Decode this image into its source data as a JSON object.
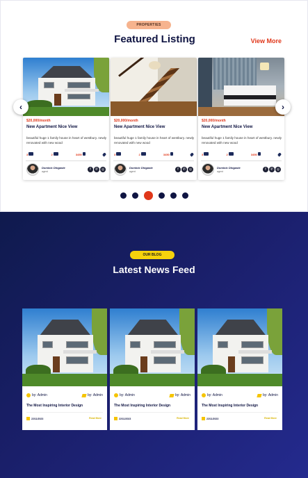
{
  "featured": {
    "tag": "PROPERTIES",
    "title": "Featured Listing",
    "view_more": "View More",
    "prev_icon": "chevron-left-icon",
    "next_icon": "chevron-right-icon",
    "cards": [
      {
        "image": "house-photo",
        "price": "$20,000/month",
        "title": "New Apartment Nice View",
        "description": "beautiful huge 1 family house in heart of westbury. newly renovated with new wood",
        "beds": "3",
        "baths": "2",
        "area": "3450",
        "agent_name": "Dominic Dhigaste",
        "agent_role": "agent"
      },
      {
        "image": "staircase-photo",
        "price": "$20,000/month",
        "title": "New Apartment Nice View",
        "description": "beautiful huge 1 family house in heart of westbury. newly renovated with new wood",
        "beds": "3",
        "baths": "2",
        "area": "3450",
        "agent_name": "Dominic Dhigaste",
        "agent_role": "agent"
      },
      {
        "image": "bedroom-photo",
        "price": "$20,000/month",
        "title": "New Apartment Nice View",
        "description": "beautiful huge 1 family house in heart of westbury. newly renovated with new wood",
        "beds": "3",
        "baths": "2",
        "area": "3450",
        "agent_name": "Dominic Dhigaste",
        "agent_role": "agent"
      }
    ],
    "social_icons": [
      "facebook-icon",
      "whatsapp-icon",
      "instagram-icon"
    ],
    "pagination": {
      "count": 6,
      "active": 3
    }
  },
  "blog": {
    "tag": "OUR BLOG",
    "title": "Latest News Feed",
    "posts": [
      {
        "image": "house-photo",
        "author": "by: Admin",
        "tag": "by: Admin",
        "headline": "The Most Inspiring Interior Design",
        "date": "22/11/2023",
        "read_more": "Read More"
      },
      {
        "image": "house-photo",
        "author": "by: Admin",
        "tag": "by: Admin",
        "headline": "The Most Inspiring Interior Design",
        "date": "22/11/2023",
        "read_more": "Read More"
      },
      {
        "image": "house-photo",
        "author": "by: Admin",
        "tag": "by: Admin",
        "headline": "The Most Inspiring Interior Design",
        "date": "22/11/2023",
        "read_more": "Read More"
      }
    ]
  },
  "colors": {
    "accent": "#e0371a",
    "navy": "#0f1442",
    "blog_bg": "#1a1f6a",
    "yellow": "#f5d20c"
  }
}
